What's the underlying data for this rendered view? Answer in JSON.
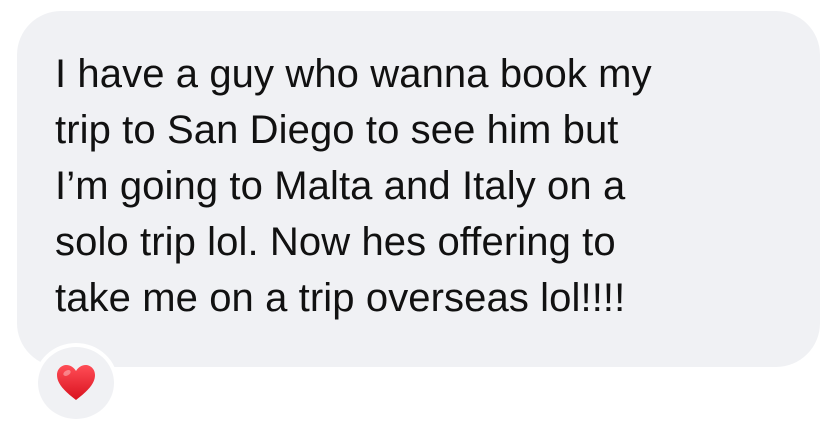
{
  "message": {
    "lines": [
      "I have a guy who wanna book my",
      "trip to San Diego to see him but",
      "I’m going to Malta and Italy on a",
      "solo trip lol. Now hes offering to",
      "take me on a trip overseas lol!!!!"
    ]
  },
  "reaction": {
    "icon": "red-heart-icon",
    "color": "#e8202e"
  },
  "colors": {
    "bubble": "#f0f1f4",
    "text": "#111111",
    "background": "#ffffff"
  }
}
